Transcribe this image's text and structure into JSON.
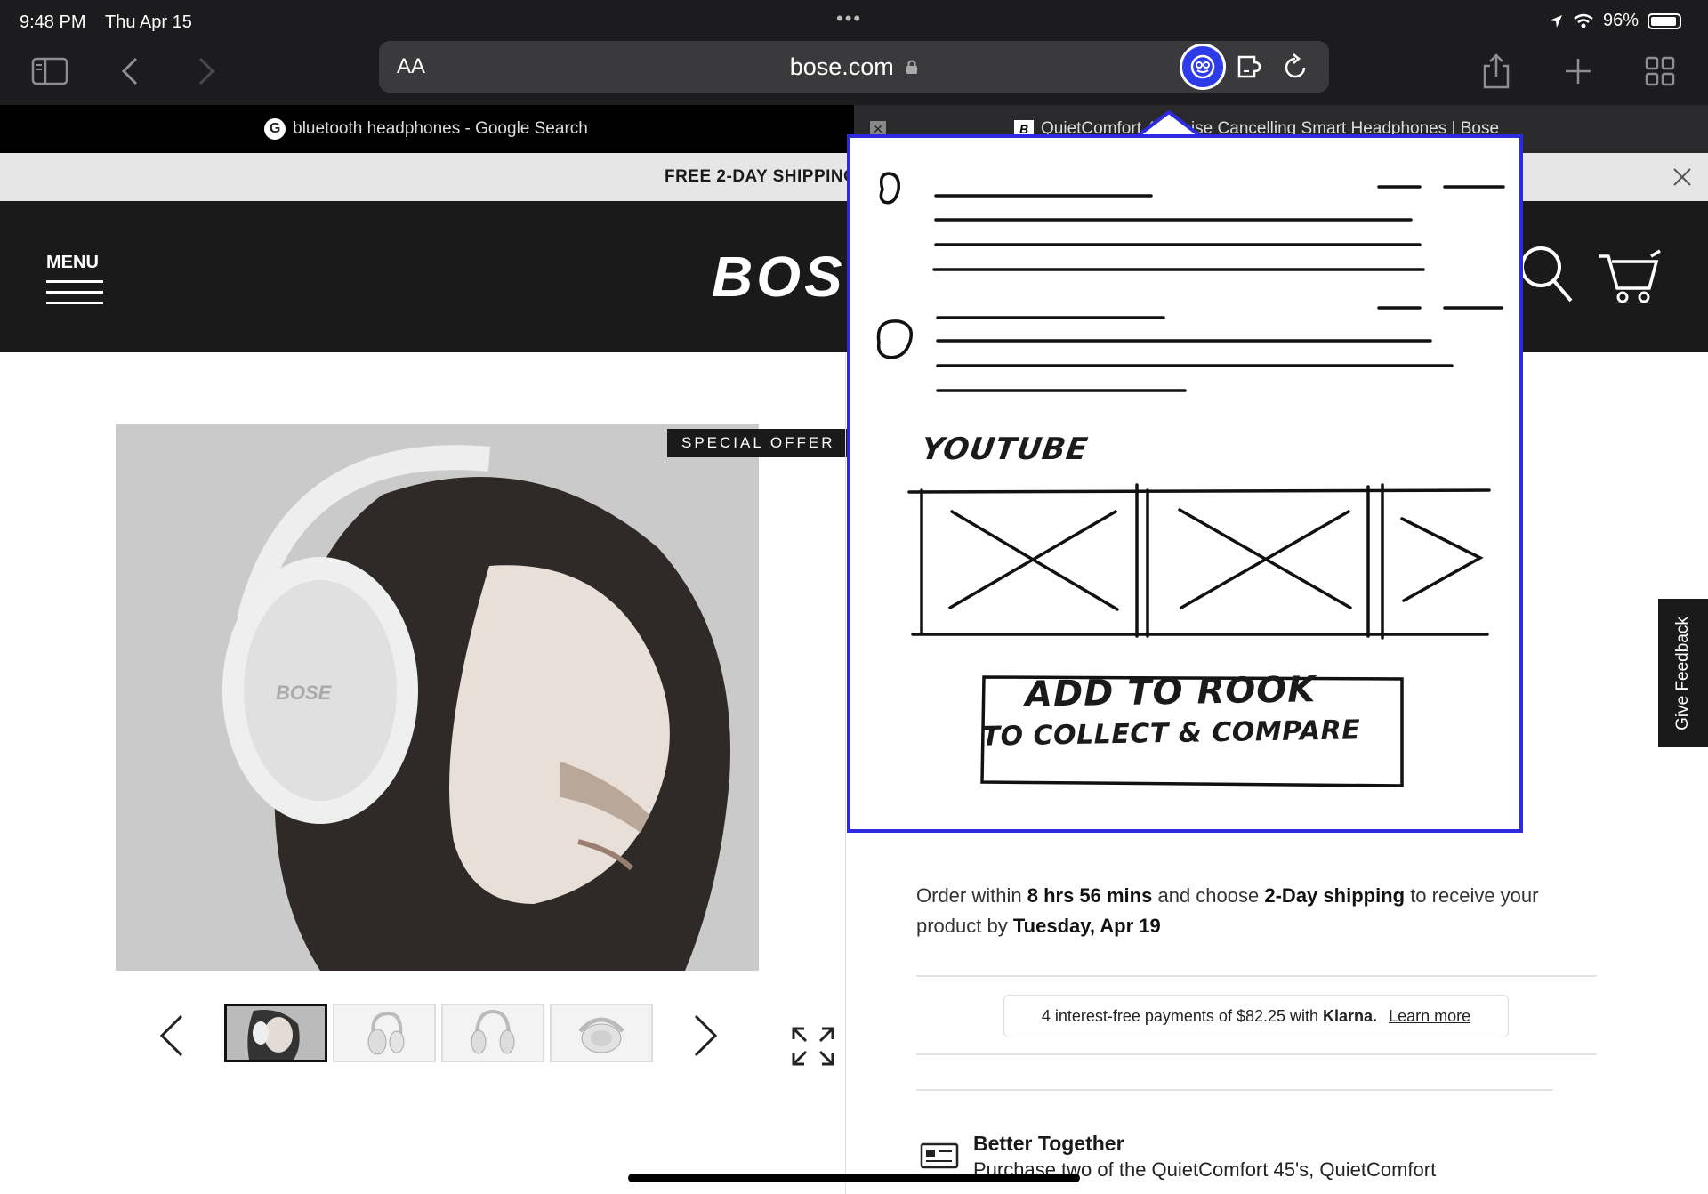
{
  "status_bar": {
    "time": "9:48 PM",
    "date": "Thu Apr 15",
    "battery": "96%",
    "more_dots": "•••"
  },
  "toolbar": {
    "text_size_label": "AA",
    "url": "bose.com"
  },
  "tabs": [
    {
      "title": "bluetooth headphones - Google Search",
      "favicon": "G"
    },
    {
      "title": "QuietComfort 45 Noise Cancelling Smart Headphones | Bose",
      "favicon": "B"
    }
  ],
  "site": {
    "promo_text": "FREE 2-DAY SHIPPING FOR ORDERS OF $50",
    "menu_label": "MENU",
    "logo_text": "BOSE",
    "special_offer": "SPECIAL OFFER",
    "order_info": {
      "prefix": "Order within",
      "time_left": "8 hrs 56 mins",
      "middle": "and choose",
      "shipping": "2-Day shipping",
      "suffix": "to receive your product by",
      "delivery_date": "Tuesday, Apr 19"
    },
    "klarna": {
      "text": "4 interest-free payments of $82.25 with",
      "brand": "Klarna.",
      "link": "Learn more"
    },
    "better_together": {
      "title": "Better Together",
      "description": "Purchase two of the QuietComfort 45's, QuietComfort"
    },
    "feedback_label": "Give Feedback"
  },
  "popup": {
    "section_label": "YOUTUBE",
    "cta_line1": "ADD TO ROOK",
    "cta_line2": "TO COLLECT & COMPARE"
  },
  "colors": {
    "accent": "#2d2be0",
    "chrome": "#1c1c1e",
    "header": "#1a1a1a"
  }
}
